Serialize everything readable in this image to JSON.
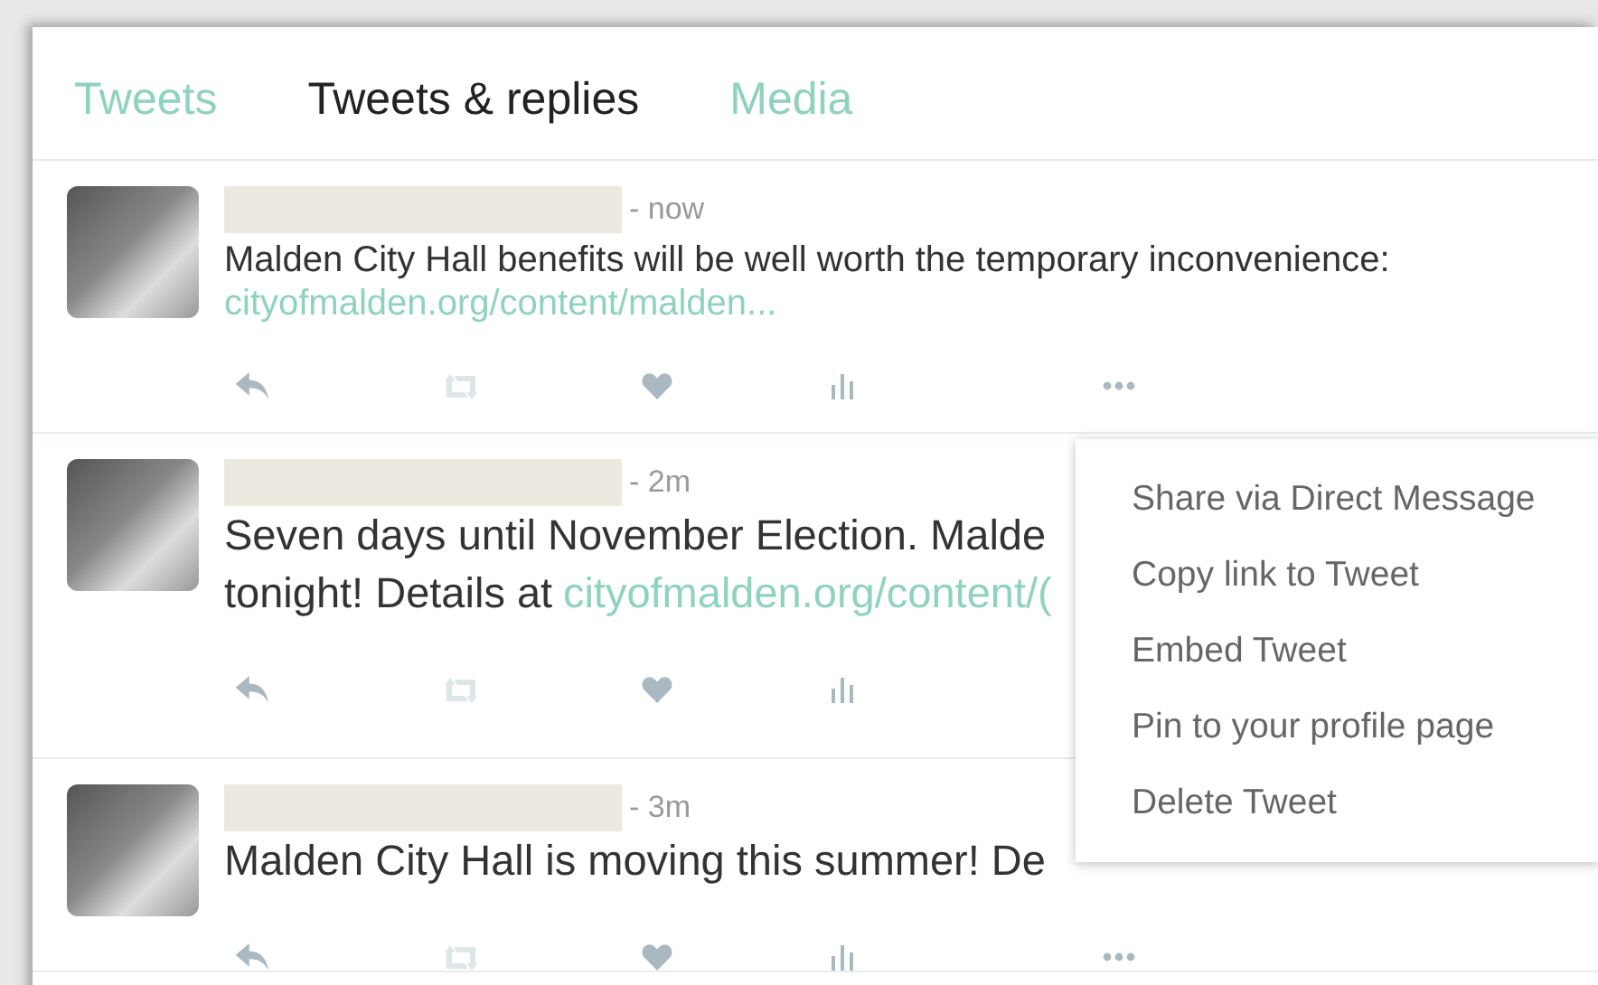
{
  "tabs": [
    {
      "label": "Tweets",
      "selected": false
    },
    {
      "label": "Tweets & replies",
      "selected": true
    },
    {
      "label": "Media",
      "selected": false
    }
  ],
  "tweets": [
    {
      "time": "- now",
      "large": false,
      "lines": [
        [
          {
            "kind": "text",
            "text": "Malden City Hall benefits will be well worth the temporary inconvenience:"
          }
        ],
        [
          {
            "kind": "link",
            "text": "cityofmalden.org/content/malden..."
          }
        ]
      ]
    },
    {
      "time": "- 2m",
      "large": true,
      "lines": [
        [
          {
            "kind": "text",
            "text": "Seven days until November Election. Malde"
          }
        ],
        [
          {
            "kind": "text",
            "text": "tonight! Details at"
          },
          {
            "kind": "link",
            "text": "cityofmalden.org/content/("
          }
        ]
      ]
    },
    {
      "time": "- 3m",
      "large": true,
      "lines": [
        [
          {
            "kind": "text",
            "text": "Malden City Hall is moving this summer! De"
          }
        ]
      ]
    }
  ],
  "menu": {
    "items": [
      "Share via Direct Message",
      "Copy link to Tweet",
      "Embed Tweet",
      "Pin to your profile page",
      "Delete Tweet"
    ]
  }
}
